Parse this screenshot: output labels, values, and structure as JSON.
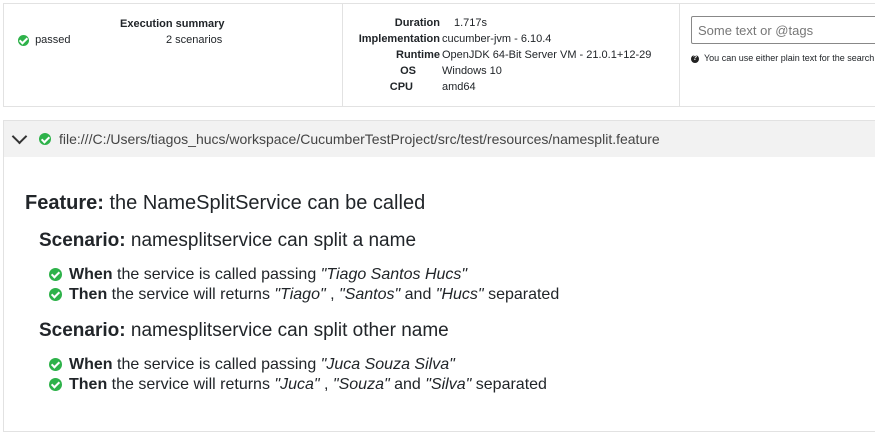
{
  "summary": {
    "title": "Execution summary",
    "status": "passed",
    "scenario_count": "2 scenarios",
    "details": [
      {
        "key": "Duration",
        "value": "1.717s"
      },
      {
        "key": "Implementation",
        "value": "cucumber-jvm - 6.10.4"
      },
      {
        "key": "Runtime",
        "value": "OpenJDK 64-Bit Server VM - 21.0.1+12-29"
      },
      {
        "key": "OS",
        "value": "Windows 10"
      },
      {
        "key": "CPU",
        "value": "amd64"
      }
    ],
    "search": {
      "placeholder": "Some text or @tags",
      "help": "You can use either plain text for the search o"
    }
  },
  "feature_file": {
    "path": "file:///C:/Users/tiagos_hucs/workspace/CucumberTestProject/src/test/resources/namesplit.feature",
    "feature_keyword": "Feature:",
    "feature_name": "the NameSplitService can be called",
    "scenarios": [
      {
        "keyword": "Scenario:",
        "name": "namesplitservice can split a name",
        "steps": [
          {
            "keyword": "When",
            "t1": "the service is called passing",
            "a1": "\"Tiago Santos Hucs\""
          },
          {
            "keyword": "Then",
            "t1": "the service will returns",
            "a1": "\"Tiago\"",
            "t2": ",",
            "a2": "\"Santos\"",
            "t3": "and",
            "a3": "\"Hucs\"",
            "t4": "separated"
          }
        ]
      },
      {
        "keyword": "Scenario:",
        "name": "namesplitservice can split other name",
        "steps": [
          {
            "keyword": "When",
            "t1": "the service is called passing",
            "a1": "\"Juca Souza Silva\""
          },
          {
            "keyword": "Then",
            "t1": "the service will returns",
            "a1": "\"Juca\"",
            "t2": ",",
            "a2": "\"Souza\"",
            "t3": "and",
            "a3": "\"Silva\"",
            "t4": "separated"
          }
        ]
      }
    ]
  },
  "colors": {
    "passed": "#2eb24a",
    "header_bg": "#f2f2f2",
    "border": "#e2e2e2"
  },
  "icons": {
    "status": "check-circle-icon",
    "collapse": "chevron-down-icon",
    "help": "question-circle-icon"
  }
}
